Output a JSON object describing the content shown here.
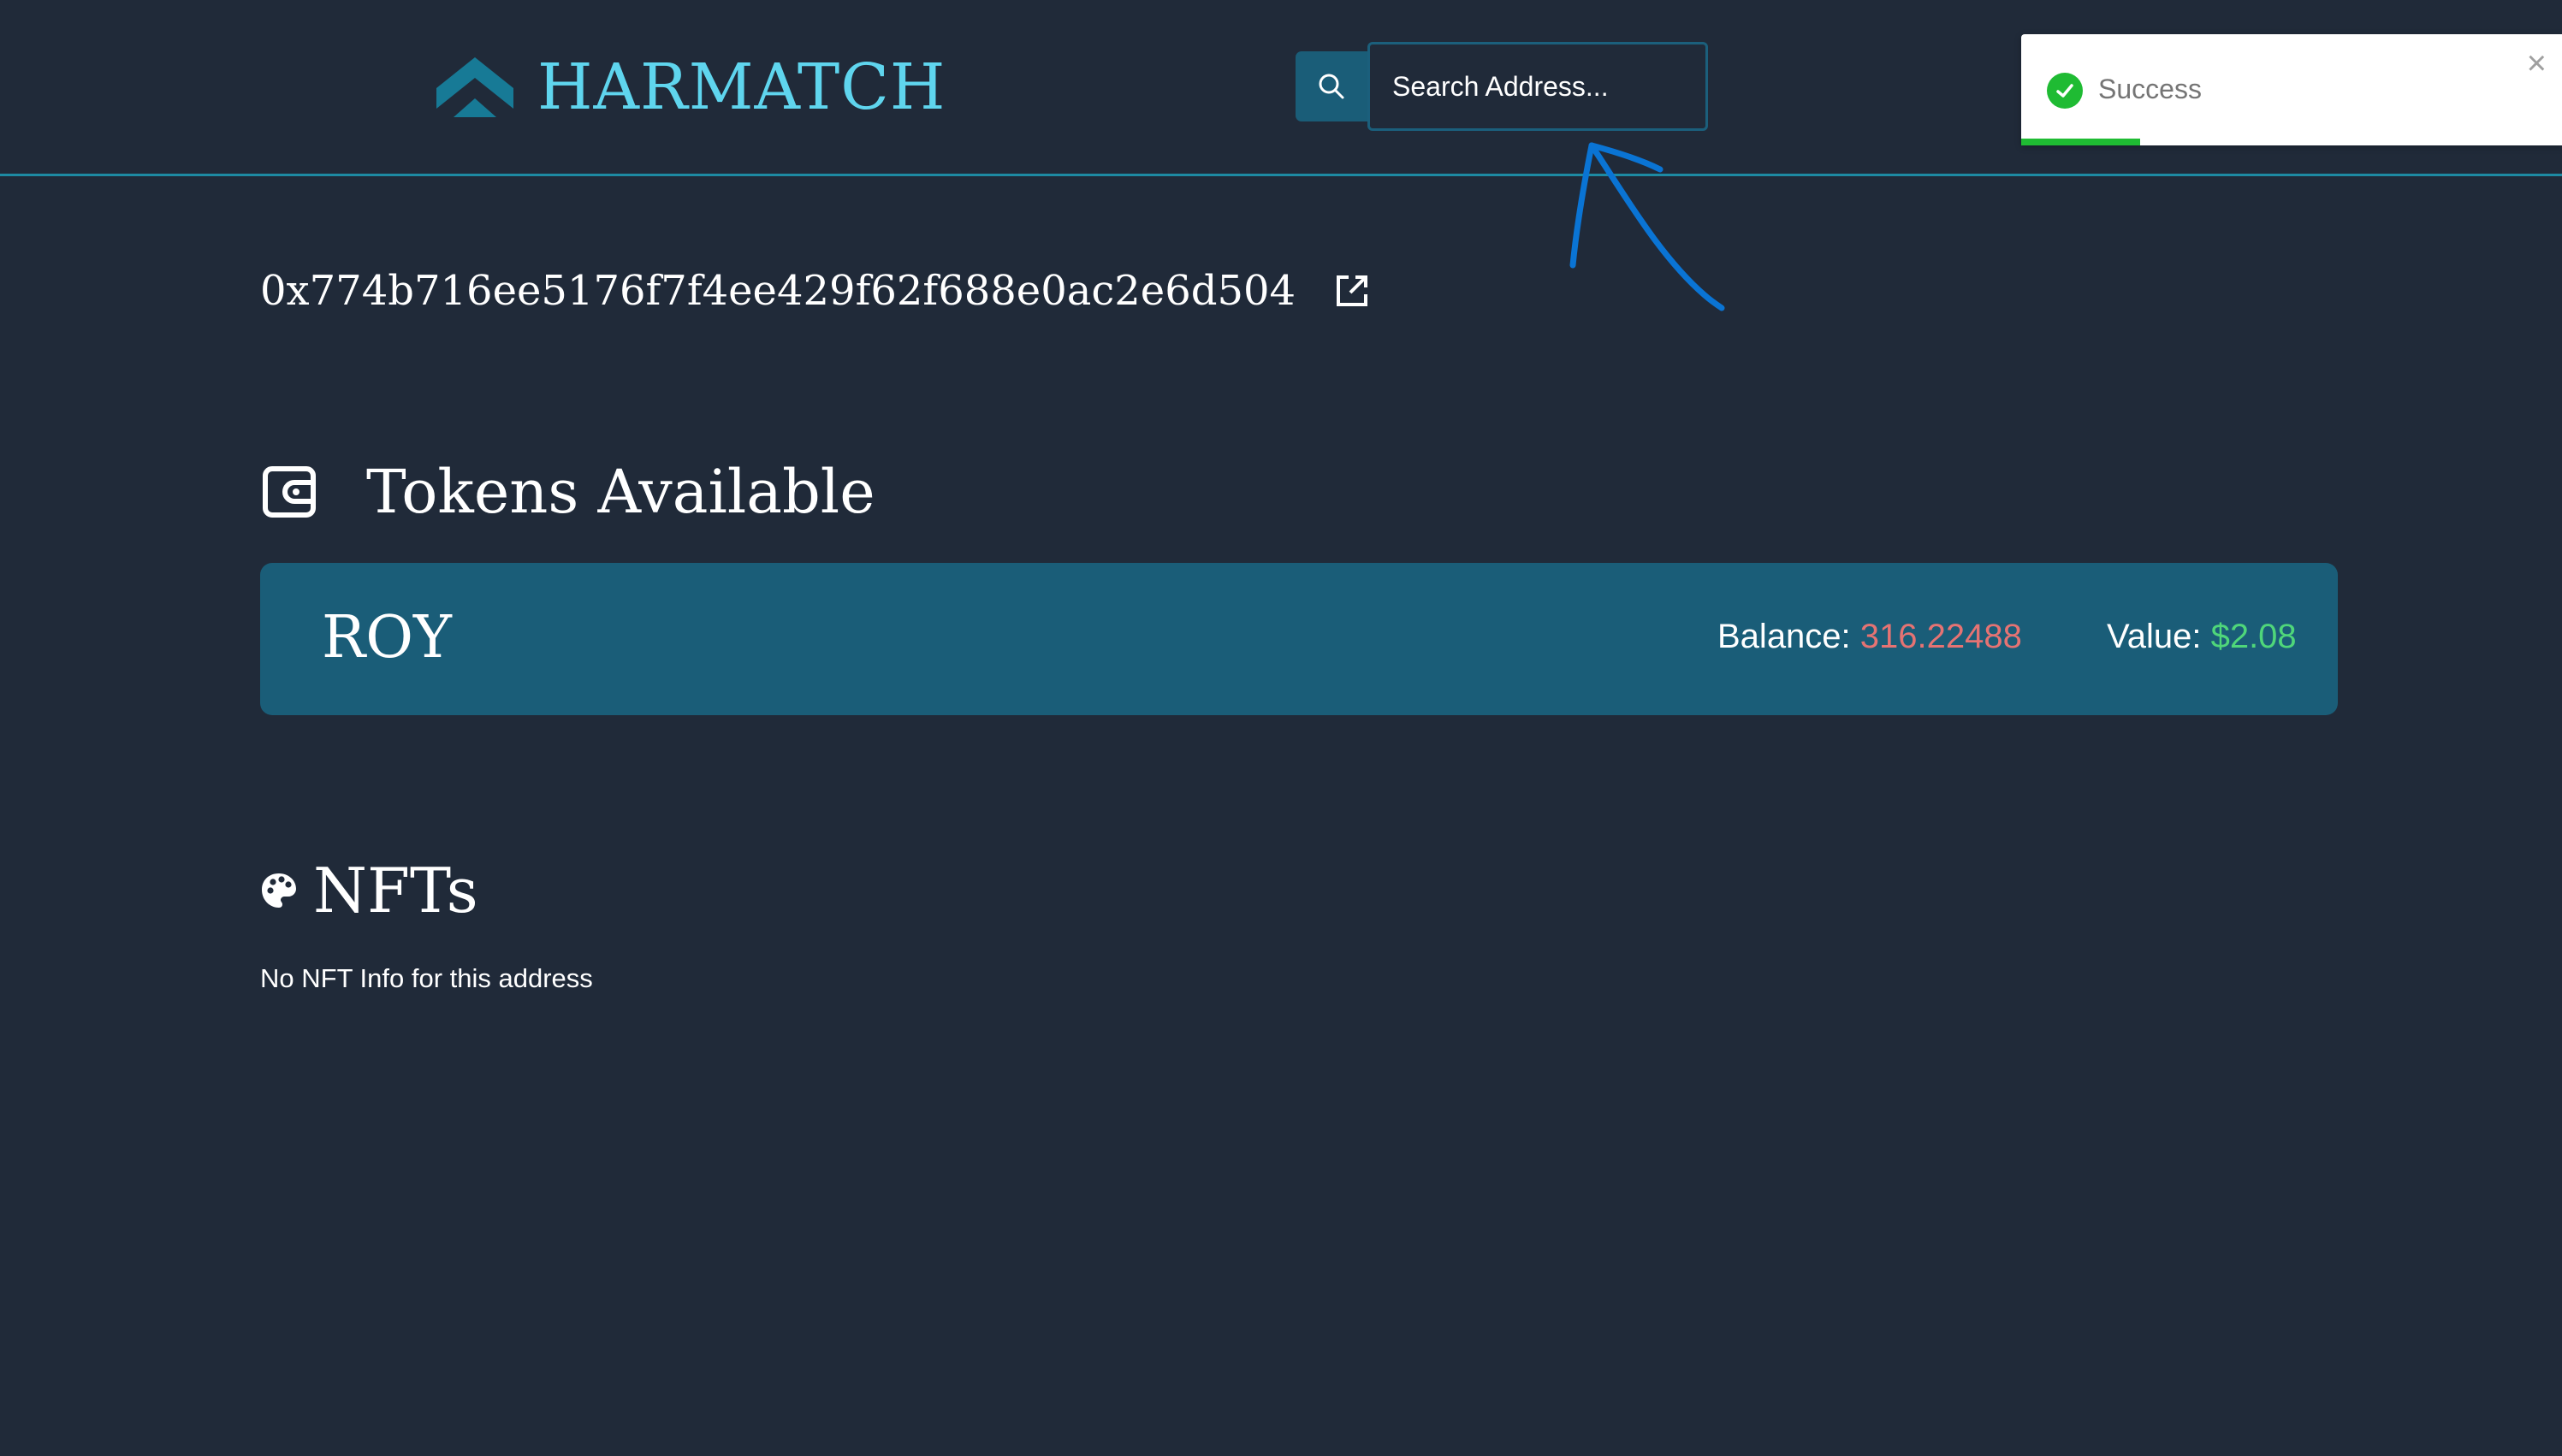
{
  "header": {
    "brand": "HARMATCH",
    "search": {
      "placeholder": "Search Address..."
    }
  },
  "toast": {
    "message": "Success",
    "close_label": "×",
    "progress": 0.22,
    "status_color": "#1fbb33"
  },
  "wallet": {
    "address": "0x774b716ee5176f7f4ee429f62f688e0ac2e6d504"
  },
  "tokens": {
    "title": "Tokens Available",
    "items": [
      {
        "symbol": "ROY",
        "balance_label": "Balance:",
        "balance": "316.22488",
        "value_label": "Value:",
        "value": "$2.08"
      }
    ]
  },
  "nfts": {
    "title": "NFTs",
    "empty_message": "No NFT Info for this address"
  },
  "icons": {
    "logo": "harmatch-logo-icon",
    "search": "search-icon",
    "external_link": "external-link-icon",
    "wallet": "wallet-icon",
    "palette": "palette-icon",
    "success": "check-circle-icon",
    "close": "close-icon"
  },
  "colors": {
    "background": "#202a39",
    "accent": "#5fd5ee",
    "card": "#1a5d78",
    "balance": "#e57373",
    "value": "#4fd67a",
    "annotation": "#0a74d4"
  }
}
